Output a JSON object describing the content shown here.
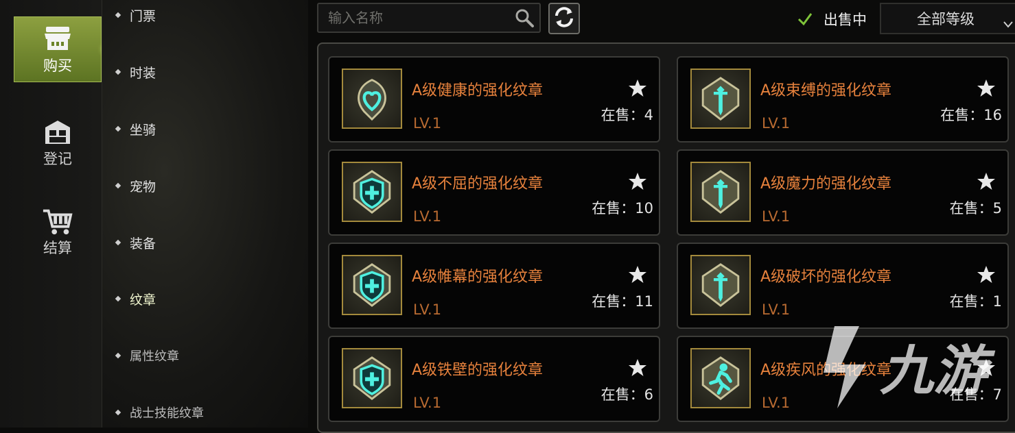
{
  "nav": [
    {
      "label": "购买",
      "icon": "shop-icon",
      "active": true
    },
    {
      "label": "登记",
      "icon": "register-icon",
      "active": false
    },
    {
      "label": "结算",
      "icon": "cart-icon",
      "active": false
    }
  ],
  "categories": [
    {
      "label": "门票",
      "active": false
    },
    {
      "label": "时装",
      "active": false
    },
    {
      "label": "坐骑",
      "active": false
    },
    {
      "label": "宠物",
      "active": false
    },
    {
      "label": "装备",
      "active": false
    },
    {
      "label": "纹章",
      "active": true
    },
    {
      "label": "属性纹章",
      "active": false,
      "sub": true
    },
    {
      "label": "战士技能纹章",
      "active": false,
      "sub": true
    }
  ],
  "search": {
    "placeholder": "输入名称"
  },
  "filter": {
    "on_sale_label": "出售中",
    "on_sale_checked": true,
    "level_select": "全部等级"
  },
  "stock_prefix": "在售：",
  "items": [
    {
      "name": "A级健康的强化纹章",
      "level": "LV.1",
      "stock": "在售：4",
      "emblem": "heart"
    },
    {
      "name": "A级束缚的强化纹章",
      "level": "LV.1",
      "stock": "在售：16",
      "emblem": "sword"
    },
    {
      "name": "A级不屈的强化纹章",
      "level": "LV.1",
      "stock": "在售：10",
      "emblem": "shield"
    },
    {
      "name": "A级魔力的强化纹章",
      "level": "LV.1",
      "stock": "在售：5",
      "emblem": "sword"
    },
    {
      "name": "A级帷幕的强化纹章",
      "level": "LV.1",
      "stock": "在售：11",
      "emblem": "shield"
    },
    {
      "name": "A级破坏的强化纹章",
      "level": "LV.1",
      "stock": "在售：1",
      "emblem": "sword"
    },
    {
      "name": "A级铁壁的强化纹章",
      "level": "LV.1",
      "stock": "在售：6",
      "emblem": "shield"
    },
    {
      "name": "A级疾风的强化纹章",
      "level": "LV.1",
      "stock": "在售：7",
      "emblem": "runner"
    }
  ],
  "watermark": "九游",
  "colors": {
    "accent": "#8da040",
    "item_name": "#e6813c",
    "level": "#b86a31",
    "check": "#7fc43a"
  }
}
